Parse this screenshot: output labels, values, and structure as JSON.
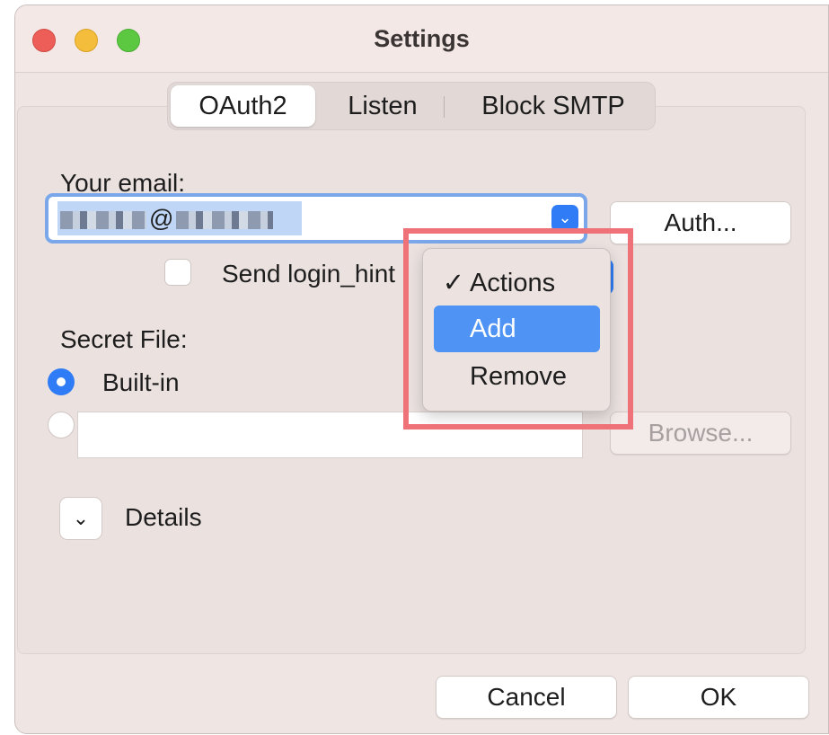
{
  "window": {
    "title": "Settings"
  },
  "tabs": [
    {
      "label": "OAuth2",
      "active": true
    },
    {
      "label": "Listen",
      "active": false
    },
    {
      "label": "Block SMTP",
      "active": false
    }
  ],
  "oauth2": {
    "email_label": "Your email:",
    "email_value_visible_char": "@",
    "auth_button": "Auth...",
    "send_login_hint": {
      "label": "Send login_hint",
      "checked": false
    },
    "secret_file_label": "Secret File:",
    "secret_options": [
      {
        "label": "Built-in",
        "selected": true
      },
      {
        "label": "",
        "selected": false
      }
    ],
    "file_path": "",
    "browse_button": "Browse...",
    "details_label": "Details"
  },
  "actions_menu": {
    "items": [
      {
        "label": "Actions",
        "checked": true,
        "highlighted": false
      },
      {
        "label": "Add",
        "checked": false,
        "highlighted": true
      },
      {
        "label": "Remove",
        "checked": false,
        "highlighted": false
      }
    ],
    "checkmark": "✓"
  },
  "footer": {
    "cancel_button": "Cancel",
    "ok_button": "OK"
  },
  "colors": {
    "accent": "#2f7cf6",
    "menu_highlight": "#4f94f5",
    "annotation_box": "#f07279"
  }
}
